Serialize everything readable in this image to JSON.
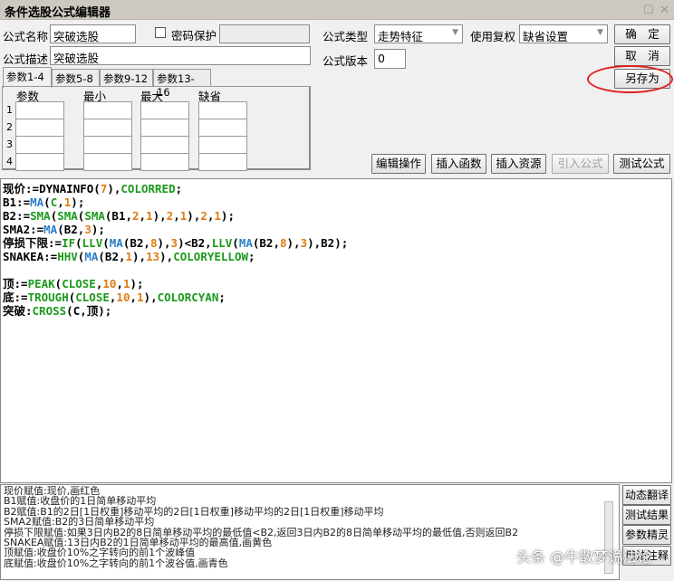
{
  "window": {
    "title": "条件选股公式编辑器"
  },
  "form": {
    "name_label": "公式名称",
    "name_value": "突破选股",
    "password_label": "密码保护",
    "desc_label": "公式描述",
    "desc_value": "突破选股",
    "type_label": "公式类型",
    "type_value": "走势特征",
    "fq_label": "使用复权",
    "fq_value": "缺省设置",
    "version_label": "公式版本",
    "version_value": "0"
  },
  "buttons": {
    "ok": "确　定",
    "cancel": "取　消",
    "save_as": "另存为",
    "edit_ops": "编辑操作",
    "insert_func": "插入函数",
    "insert_res": "插入资源",
    "import_formula": "引入公式",
    "test_formula": "测试公式",
    "dyn_translate": "动态翻译",
    "test_result": "测试结果",
    "param_wizard": "参数精灵",
    "usage": "用法注释"
  },
  "tabs": [
    "参数1-4",
    "参数5-8",
    "参数9-12",
    "参数13-16"
  ],
  "param_headers": [
    "参数",
    "最小",
    "最大",
    "缺省"
  ],
  "param_rows": [
    "1",
    "2",
    "3",
    "4"
  ],
  "colors": {
    "keyword": "#1a9a1a",
    "ma": "#2a7fc8",
    "number": "#e07a10",
    "ident": "#000000",
    "highlight": "#e02020"
  },
  "code": [
    [
      [
        "现价:=",
        "i"
      ],
      [
        "DYNAINFO",
        "i"
      ],
      [
        "(",
        "i"
      ],
      [
        "7",
        "n"
      ],
      [
        "),",
        "i"
      ],
      [
        "COLORRED",
        "k"
      ],
      [
        ";",
        "i"
      ]
    ],
    [
      [
        "B1:=",
        "i"
      ],
      [
        "MA",
        "m"
      ],
      [
        "(",
        "i"
      ],
      [
        "C",
        "k"
      ],
      [
        ",",
        "i"
      ],
      [
        "1",
        "n"
      ],
      [
        ");",
        "i"
      ]
    ],
    [
      [
        "B2:=",
        "i"
      ],
      [
        "SMA",
        "k"
      ],
      [
        "(",
        "i"
      ],
      [
        "SMA",
        "k"
      ],
      [
        "(",
        "i"
      ],
      [
        "SMA",
        "k"
      ],
      [
        "(B1,",
        "i"
      ],
      [
        "2",
        "n"
      ],
      [
        ",",
        "i"
      ],
      [
        "1",
        "n"
      ],
      [
        "),",
        "i"
      ],
      [
        "2",
        "n"
      ],
      [
        ",",
        "i"
      ],
      [
        "1",
        "n"
      ],
      [
        "),",
        "i"
      ],
      [
        "2",
        "n"
      ],
      [
        ",",
        "i"
      ],
      [
        "1",
        "n"
      ],
      [
        ");",
        "i"
      ]
    ],
    [
      [
        "SMA2:=",
        "i"
      ],
      [
        "MA",
        "m"
      ],
      [
        "(B2,",
        "i"
      ],
      [
        "3",
        "n"
      ],
      [
        ");",
        "i"
      ]
    ],
    [
      [
        "停损下限:=",
        "i"
      ],
      [
        "IF",
        "k"
      ],
      [
        "(",
        "i"
      ],
      [
        "LLV",
        "k"
      ],
      [
        "(",
        "i"
      ],
      [
        "MA",
        "m"
      ],
      [
        "(B2,",
        "i"
      ],
      [
        "8",
        "n"
      ],
      [
        "),",
        "i"
      ],
      [
        "3",
        "n"
      ],
      [
        ")<B2,",
        "i"
      ],
      [
        "LLV",
        "k"
      ],
      [
        "(",
        "i"
      ],
      [
        "MA",
        "m"
      ],
      [
        "(B2,",
        "i"
      ],
      [
        "8",
        "n"
      ],
      [
        "),",
        "i"
      ],
      [
        "3",
        "n"
      ],
      [
        "),B2);",
        "i"
      ]
    ],
    [
      [
        "SNAKEA:=",
        "i"
      ],
      [
        "HHV",
        "k"
      ],
      [
        "(",
        "i"
      ],
      [
        "MA",
        "m"
      ],
      [
        "(B2,",
        "i"
      ],
      [
        "1",
        "n"
      ],
      [
        "),",
        "i"
      ],
      [
        "13",
        "n"
      ],
      [
        "),",
        "i"
      ],
      [
        "COLORYELLOW",
        "k"
      ],
      [
        ";",
        "i"
      ]
    ],
    [],
    [
      [
        "顶:=",
        "i"
      ],
      [
        "PEAK",
        "k"
      ],
      [
        "(",
        "i"
      ],
      [
        "CLOSE",
        "k"
      ],
      [
        ",",
        "i"
      ],
      [
        "10",
        "n"
      ],
      [
        ",",
        "i"
      ],
      [
        "1",
        "n"
      ],
      [
        ");",
        "i"
      ]
    ],
    [
      [
        "底:=",
        "i"
      ],
      [
        "TROUGH",
        "k"
      ],
      [
        "(",
        "i"
      ],
      [
        "CLOSE",
        "k"
      ],
      [
        ",",
        "i"
      ],
      [
        "10",
        "n"
      ],
      [
        ",",
        "i"
      ],
      [
        "1",
        "n"
      ],
      [
        "),",
        "i"
      ],
      [
        "COLORCYAN",
        "k"
      ],
      [
        ";",
        "i"
      ]
    ],
    [
      [
        "突破:",
        "i"
      ],
      [
        "CROSS",
        "k"
      ],
      [
        "(C,顶);",
        "i"
      ]
    ]
  ],
  "explain": [
    "现价赋值:现价,画红色",
    "B1赋值:收盘价的1日简单移动平均",
    "B2赋值:B1的2日[1日权重]移动平均的2日[1日权重]移动平均的2日[1日权重]移动平均",
    "SMA2赋值:B2的3日简单移动平均",
    "停损下限赋值:如果3日内B2的8日简单移动平均的最低值<B2,返回3日内B2的8日简单移动平均的最低值,否则返回B2",
    "SNAKEA赋值:13日内B2的1日简单移动平均的最高值,画黄色",
    "顶赋值:收盘价10%之字转向的前1个波峰值",
    "底赋值:收盘价10%之字转向的前1个波谷值,画青色"
  ],
  "watermark": "头条 @牛散梦说法论"
}
